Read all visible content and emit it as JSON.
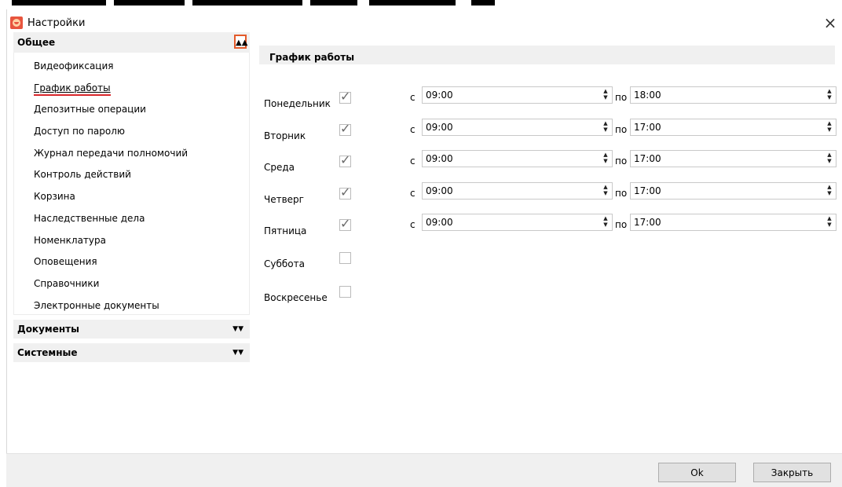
{
  "window": {
    "title": "Настройки",
    "close_glyph": "×"
  },
  "nav": {
    "groups": [
      {
        "label": "Общее",
        "expanded": true,
        "items": [
          "Видеофиксация",
          "График работы",
          "Депозитные операции",
          "Доступ по паролю",
          "Журнал передачи полномочий",
          "Контроль действий",
          "Корзина",
          "Наследственные дела",
          "Номенклатура",
          "Оповещения",
          "Справочники",
          "Электронные документы"
        ],
        "selected_index": 1
      },
      {
        "label": "Документы",
        "expanded": false
      },
      {
        "label": "Системные",
        "expanded": false
      }
    ],
    "chev_up": "⌃",
    "chev_down": "⌄"
  },
  "panel": {
    "title": "График работы",
    "from_label": "с",
    "to_label": "по",
    "days": [
      {
        "name": "Понедельник",
        "checked": true,
        "from": "09:00",
        "to": "18:00"
      },
      {
        "name": "Вторник",
        "checked": true,
        "from": "09:00",
        "to": "17:00"
      },
      {
        "name": "Среда",
        "checked": true,
        "from": "09:00",
        "to": "17:00"
      },
      {
        "name": "Четверг",
        "checked": true,
        "from": "09:00",
        "to": "17:00"
      },
      {
        "name": "Пятница",
        "checked": true,
        "from": "09:00",
        "to": "17:00"
      },
      {
        "name": "Суббота",
        "checked": false
      },
      {
        "name": "Воскресенье",
        "checked": false
      }
    ]
  },
  "footer": {
    "ok_label": "Ok",
    "close_label": "Закрыть"
  },
  "colors": {
    "accent_border": "#e35a2a",
    "selected_underline": "#d8262b",
    "header_bg": "#f0f0f0"
  },
  "icons": {
    "app": "app-logo-icon",
    "close": "close-icon",
    "collapse": "double-chevron-up-icon",
    "expand": "double-chevron-down-icon",
    "check": "checkmark-icon",
    "spinner": "spinner-arrows-icon"
  }
}
